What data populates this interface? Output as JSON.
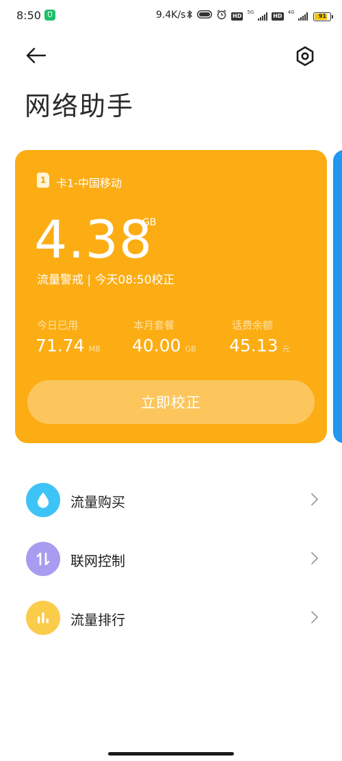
{
  "status_bar": {
    "time": "8:50",
    "net_speed": "9.4K/s",
    "sim1_hd": "HD",
    "sim1_network": "5G",
    "sim2_hd": "HD",
    "sim2_network": "4G",
    "battery": "91",
    "icons": [
      "shield-icon",
      "bluetooth-icon",
      "toggle-icon",
      "alarm-icon",
      "signal-icon",
      "battery-icon"
    ]
  },
  "header": {
    "title": "网络助手",
    "back_icon": "arrow-left-icon",
    "settings_icon": "hexagon-gear-icon"
  },
  "card": {
    "sim_badge": "1",
    "sim_label": "卡1-中国移动",
    "remaining_value": "4.38",
    "remaining_unit": "GB",
    "status_line": "流量警戒 | 今天08:50校正",
    "stats": [
      {
        "label": "今日已用",
        "value": "71.74",
        "unit": "MB"
      },
      {
        "label": "本月套餐",
        "value": "40.00",
        "unit": "GB"
      },
      {
        "label": "话费余额",
        "value": "45.13",
        "unit": "元"
      }
    ],
    "calibrate_button": "立即校正",
    "colors": {
      "card": "#fcad14",
      "button": "#fcc65c",
      "next_card": "#2196f3"
    }
  },
  "menu": [
    {
      "label": "流量购买",
      "icon": "water-drop-icon",
      "color": "#3ec3f6"
    },
    {
      "label": "联网控制",
      "icon": "up-down-arrows-icon",
      "color": "#a89cf0"
    },
    {
      "label": "流量排行",
      "icon": "bar-chart-icon",
      "color": "#fbcb4a"
    }
  ]
}
